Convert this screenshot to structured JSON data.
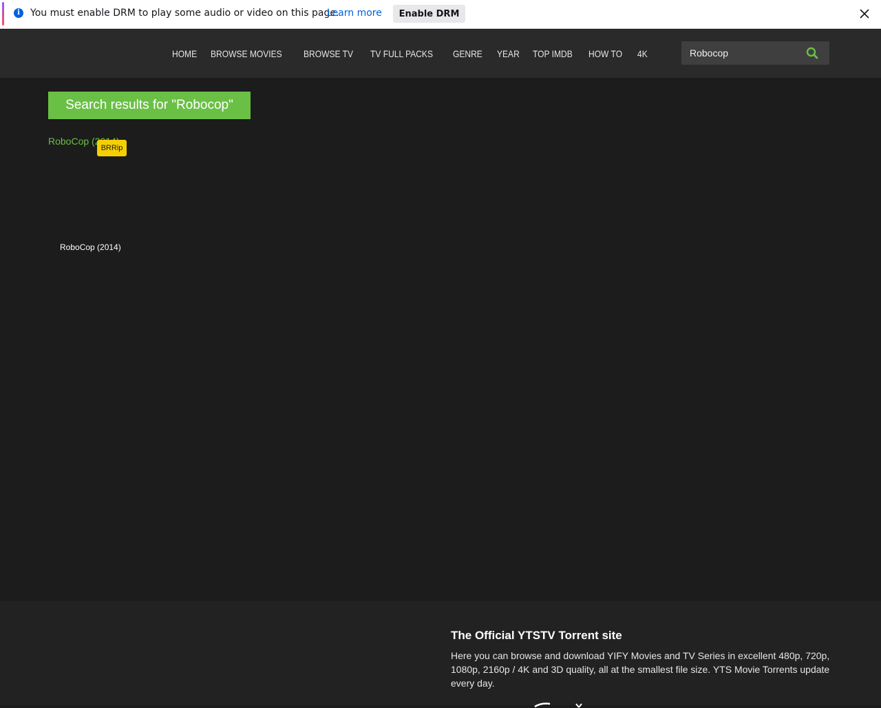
{
  "notification": {
    "message": "You must enable DRM to play some audio or video on this page.",
    "learn_more": "Learn more",
    "enable_button": "Enable DRM",
    "info_icon": "i"
  },
  "nav": {
    "items": [
      {
        "label": "HOME"
      },
      {
        "label": "BROWSE MOVIES"
      },
      {
        "label": "BROWSE TV"
      },
      {
        "label": "TV FULL PACKS"
      },
      {
        "label": "GENRE"
      },
      {
        "label": "YEAR"
      },
      {
        "label": "TOP IMDB"
      },
      {
        "label": "HOW TO"
      },
      {
        "label": "4K"
      }
    ]
  },
  "search": {
    "value": "Robocop"
  },
  "main": {
    "results_title": "Search results for \"Robocop\"",
    "result": {
      "link_text": "RoboCop (2014)",
      "quality": "BRRip",
      "caption": "RoboCop (2014)"
    }
  },
  "footer": {
    "heading": "The Official YTSTV Torrent site",
    "description": "Here you can browse and download YIFY Movies and TV Series in excellent 480p, 720p, 1080p, 2160p / 4K and 3D quality, all at the smallest file size. YTS Movie Torrents update every day."
  },
  "colors": {
    "accent": "#6ac045",
    "badge": "#f5d000",
    "background": "#1c1c1c",
    "header": "#2a2a2a"
  }
}
